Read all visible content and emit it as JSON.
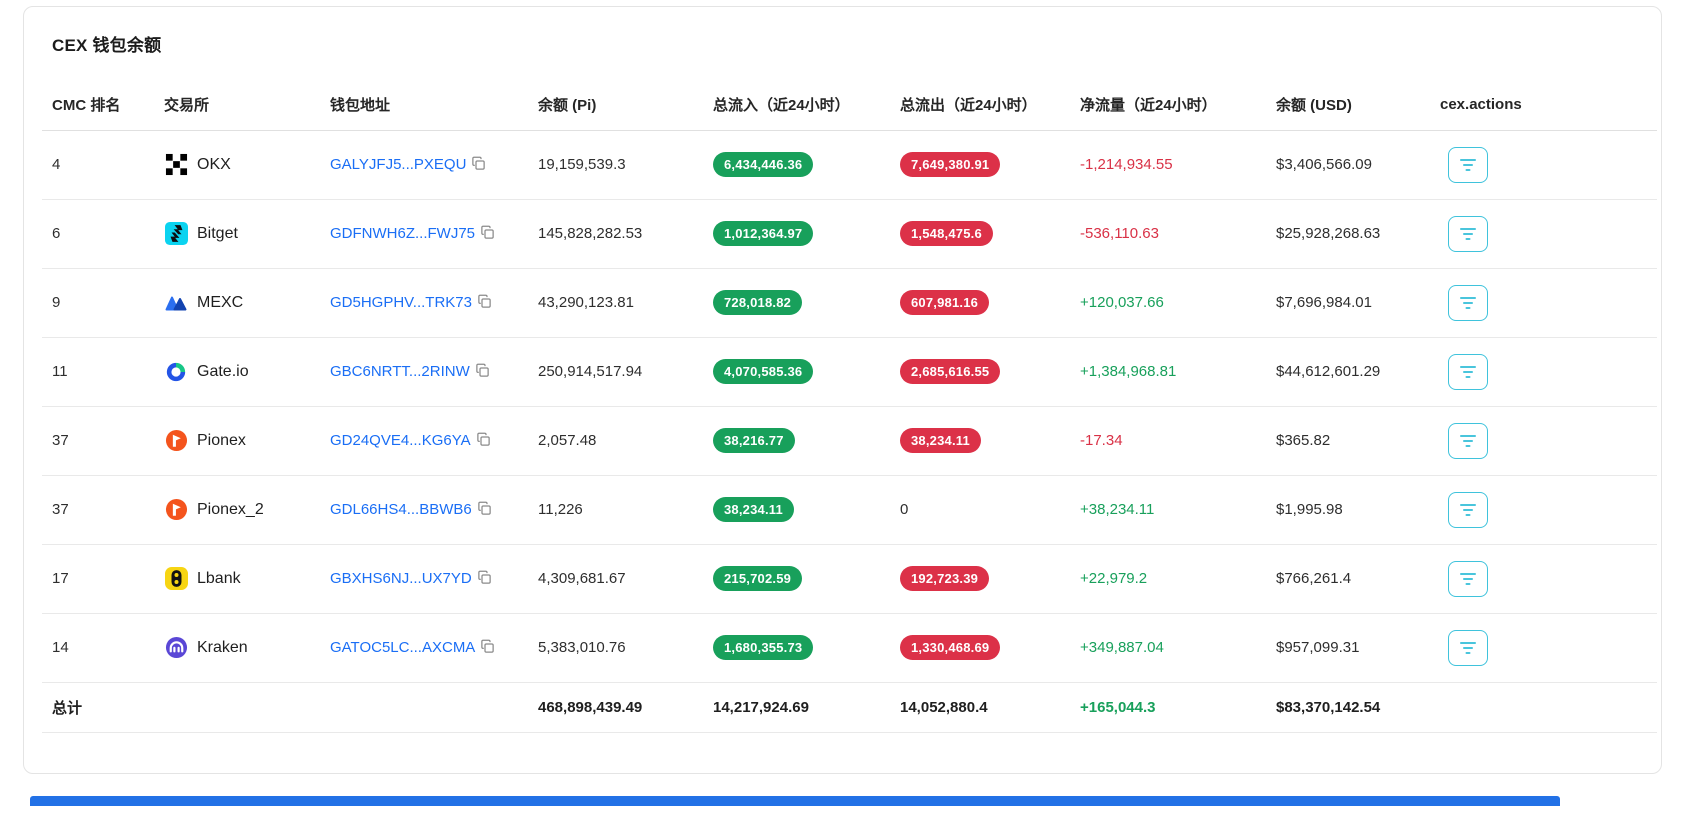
{
  "page": {
    "title": "CEX 钱包余额"
  },
  "colors": {
    "inflow_badge_green": "#18a05b",
    "outflow_badge_red": "#dc3148",
    "net_positive_green": "#18a05b",
    "net_negative_red": "#d93146",
    "address_link_blue": "#1a6ef5",
    "action_button_cyan": "#3fc3dc",
    "bottom_bar_blue": "#2271e6"
  },
  "icons": {
    "copy": "copy-icon",
    "action": "filter-lines-icon",
    "exchange_logos": [
      "okx-logo",
      "bitget-logo",
      "mexc-logo",
      "gateio-logo",
      "pionex-logo",
      "pionex-logo",
      "lbank-logo",
      "kraken-logo"
    ]
  },
  "table": {
    "headers": [
      "CMC 排名",
      "交易所",
      "钱包地址",
      "余额 (Pi)",
      "总流入（近24小时）",
      "总流出（近24小时）",
      "净流量（近24小时）",
      "余额 (USD)",
      "cex.actions"
    ],
    "rows": [
      {
        "rank": "4",
        "exchange": "OKX",
        "icon": "okx-logo",
        "address": "GALYJFJ5...PXEQU",
        "balance_pi": "19,159,539.3",
        "inflow": "6,434,446.36",
        "outflow": "7,649,380.91",
        "outflow_style": "red",
        "net": "-1,214,934.55",
        "net_dir": "neg",
        "balance_usd": "$3,406,566.09"
      },
      {
        "rank": "6",
        "exchange": "Bitget",
        "icon": "bitget-logo",
        "address": "GDFNWH6Z...FWJ75",
        "balance_pi": "145,828,282.53",
        "inflow": "1,012,364.97",
        "outflow": "1,548,475.6",
        "outflow_style": "red",
        "net": "-536,110.63",
        "net_dir": "neg",
        "balance_usd": "$25,928,268.63"
      },
      {
        "rank": "9",
        "exchange": "MEXC",
        "icon": "mexc-logo",
        "address": "GD5HGPHV...TRK73",
        "balance_pi": "43,290,123.81",
        "inflow": "728,018.82",
        "outflow": "607,981.16",
        "outflow_style": "red",
        "net": "+120,037.66",
        "net_dir": "pos",
        "balance_usd": "$7,696,984.01"
      },
      {
        "rank": "11",
        "exchange": "Gate.io",
        "icon": "gateio-logo",
        "address": "GBC6NRTT...2RINW",
        "balance_pi": "250,914,517.94",
        "inflow": "4,070,585.36",
        "outflow": "2,685,616.55",
        "outflow_style": "red",
        "net": "+1,384,968.81",
        "net_dir": "pos",
        "balance_usd": "$44,612,601.29"
      },
      {
        "rank": "37",
        "exchange": "Pionex",
        "icon": "pionex-logo",
        "address": "GD24QVE4...KG6YA",
        "balance_pi": "2,057.48",
        "inflow": "38,216.77",
        "outflow": "38,234.11",
        "outflow_style": "red",
        "net": "-17.34",
        "net_dir": "neg",
        "balance_usd": "$365.82"
      },
      {
        "rank": "37",
        "exchange": "Pionex_2",
        "icon": "pionex-logo",
        "address": "GDL66HS4...BBWB6",
        "balance_pi": "11,226",
        "inflow": "38,234.11",
        "outflow": "0",
        "outflow_style": "none",
        "net": "+38,234.11",
        "net_dir": "pos",
        "balance_usd": "$1,995.98"
      },
      {
        "rank": "17",
        "exchange": "Lbank",
        "icon": "lbank-logo",
        "address": "GBXHS6NJ...UX7YD",
        "balance_pi": "4,309,681.67",
        "inflow": "215,702.59",
        "outflow": "192,723.39",
        "outflow_style": "red",
        "net": "+22,979.2",
        "net_dir": "pos",
        "balance_usd": "$766,261.4"
      },
      {
        "rank": "14",
        "exchange": "Kraken",
        "icon": "kraken-logo",
        "address": "GATOC5LC...AXCMA",
        "balance_pi": "5,383,010.76",
        "inflow": "1,680,355.73",
        "outflow": "1,330,468.69",
        "outflow_style": "red",
        "net": "+349,887.04",
        "net_dir": "pos",
        "balance_usd": "$957,099.31"
      }
    ],
    "totals": {
      "label": "总计",
      "balance_pi": "468,898,439.49",
      "inflow": "14,217,924.69",
      "outflow": "14,052,880.4",
      "net": "+165,044.3",
      "net_dir": "pos",
      "balance_usd": "$83,370,142.54"
    }
  }
}
